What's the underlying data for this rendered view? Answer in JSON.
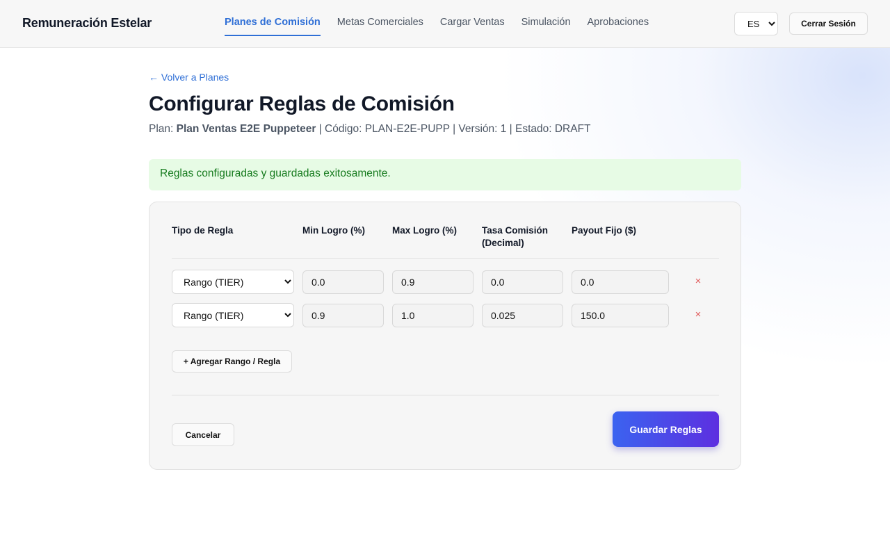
{
  "app": {
    "brand": "Remuneración Estelar"
  },
  "nav": {
    "items": [
      {
        "label": "Planes de Comisión",
        "active": true
      },
      {
        "label": "Metas Comerciales",
        "active": false
      },
      {
        "label": "Cargar Ventas",
        "active": false
      },
      {
        "label": "Simulación",
        "active": false
      },
      {
        "label": "Aprobaciones",
        "active": false
      }
    ]
  },
  "header": {
    "language": "ES",
    "logout_label": "Cerrar Sesión"
  },
  "page": {
    "back_label": "← Volver a Planes",
    "title": "Configurar Reglas de Comisión",
    "plan_prefix": "Plan: ",
    "plan_name": "Plan Ventas E2E Puppeteer",
    "plan_meta": " | Código: PLAN-E2E-PUPP | Versión: 1 | Estado: DRAFT"
  },
  "alert": {
    "message": "Reglas configuradas y guardadas exitosamente."
  },
  "table": {
    "headers": {
      "rule_type": "Tipo de Regla",
      "min": "Min Logro (%)",
      "max": "Max Logro (%)",
      "rate_line1": "Tasa Comisión",
      "rate_line2": "(Decimal)",
      "payout": "Payout Fijo ($)"
    },
    "rows": [
      {
        "type": "Rango (TIER)",
        "min": "0.0",
        "max": "0.9",
        "rate": "0.0",
        "payout": "0.0",
        "delete_icon": "close-icon"
      },
      {
        "type": "Rango (TIER)",
        "min": "0.9",
        "max": "1.0",
        "rate": "0.025",
        "payout": "150.0",
        "delete_icon": "close-icon"
      }
    ],
    "delete_glyph": "×"
  },
  "actions": {
    "add_label": "+ Agregar Rango / Regla",
    "cancel_label": "Cancelar",
    "save_label": "Guardar Reglas"
  },
  "colors": {
    "accent": "#2f6fd6",
    "success_bg": "#e7fbe5",
    "success_text": "#157a1d",
    "danger": "#e05a5a",
    "save_gradient_start": "#3b63f0",
    "save_gradient_end": "#5d2fe0"
  }
}
